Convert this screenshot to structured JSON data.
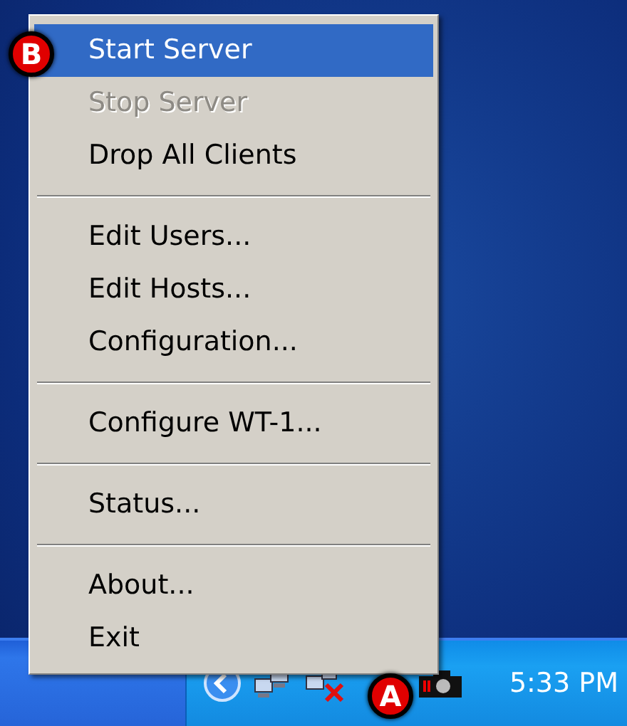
{
  "menu": {
    "items": [
      {
        "kind": "item",
        "label": "Start Server",
        "selected": true,
        "disabled": false
      },
      {
        "kind": "item",
        "label": "Stop Server",
        "selected": false,
        "disabled": true
      },
      {
        "kind": "item",
        "label": "Drop All Clients",
        "selected": false,
        "disabled": false
      },
      {
        "kind": "separator"
      },
      {
        "kind": "item",
        "label": "Edit Users...",
        "selected": false,
        "disabled": false
      },
      {
        "kind": "item",
        "label": "Edit Hosts...",
        "selected": false,
        "disabled": false
      },
      {
        "kind": "item",
        "label": "Configuration...",
        "selected": false,
        "disabled": false
      },
      {
        "kind": "separator"
      },
      {
        "kind": "item",
        "label": "Configure WT-1...",
        "selected": false,
        "disabled": false
      },
      {
        "kind": "separator"
      },
      {
        "kind": "item",
        "label": "Status...",
        "selected": false,
        "disabled": false
      },
      {
        "kind": "separator"
      },
      {
        "kind": "item",
        "label": "About...",
        "selected": false,
        "disabled": false
      },
      {
        "kind": "item",
        "label": "Exit",
        "selected": false,
        "disabled": false
      }
    ]
  },
  "callouts": [
    {
      "label": "B"
    },
    {
      "label": "A"
    }
  ],
  "taskbar": {
    "clock": "5:33 PM"
  }
}
